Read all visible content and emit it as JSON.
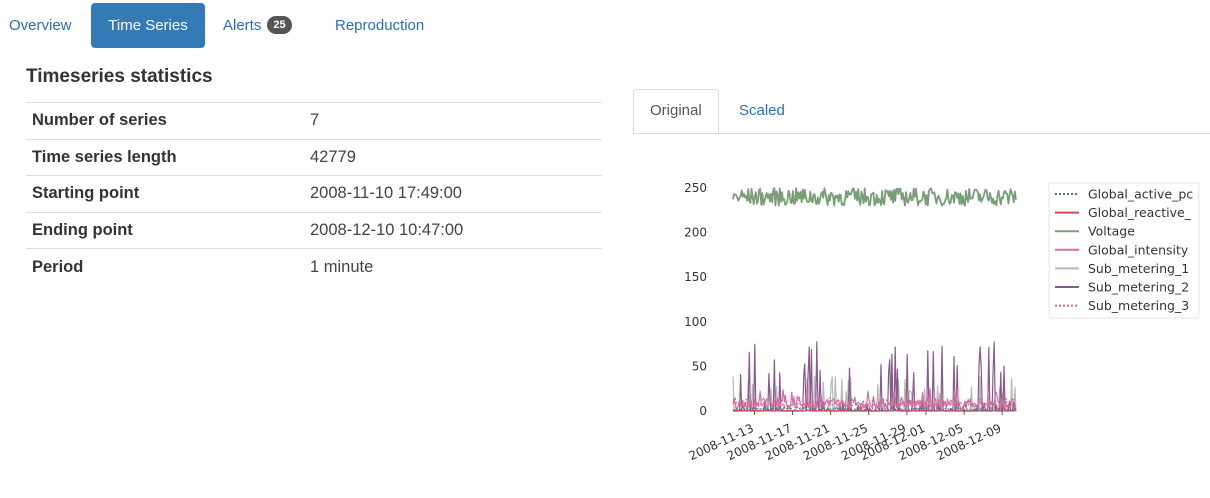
{
  "nav": {
    "items": [
      {
        "label": "Overview",
        "active": false
      },
      {
        "label": "Time Series",
        "active": true
      },
      {
        "label": "Alerts",
        "active": false,
        "badge": "25"
      },
      {
        "label": "Reproduction",
        "active": false
      }
    ]
  },
  "stats": {
    "title": "Timeseries statistics",
    "rows": [
      {
        "label": "Number of series",
        "value": "7"
      },
      {
        "label": "Time series length",
        "value": "42779"
      },
      {
        "label": "Starting point",
        "value": "2008-11-10 17:49:00"
      },
      {
        "label": "Ending point",
        "value": "2008-12-10 10:47:00"
      },
      {
        "label": "Period",
        "value": "1 minute"
      }
    ]
  },
  "chart_tabs": [
    {
      "label": "Original",
      "active": true
    },
    {
      "label": "Scaled",
      "active": false
    }
  ],
  "chart_data": {
    "type": "line",
    "title": "",
    "xlabel": "",
    "ylabel": "",
    "x_range": [
      "2008-11-10 17:49:00",
      "2008-12-10 10:47:00"
    ],
    "xticks": [
      "2008-11-13",
      "2008-11-17",
      "2008-11-21",
      "2008-11-25",
      "2008-11-29",
      "2008-12-01",
      "2008-12-05",
      "2008-12-09"
    ],
    "yticks": [
      0,
      50,
      100,
      150,
      200,
      250
    ],
    "ylim": [
      0,
      255
    ],
    "legend_position": "right",
    "series": [
      {
        "name": "Global_active_pc",
        "color": "#4c72b0",
        "dash": "dotted",
        "approx_level": 1.5,
        "approx_peak": 8
      },
      {
        "name": "Global_reactive_",
        "color": "#c44e52",
        "dash": "solid",
        "approx_level": 0.2,
        "approx_peak": 1
      },
      {
        "name": "Voltage",
        "color": "#7a9e78",
        "dash": "solid",
        "approx_level": 241,
        "approx_range": [
          230,
          250
        ]
      },
      {
        "name": "Global_intensity",
        "color": "#d46ea7",
        "dash": "solid",
        "approx_level": 6,
        "approx_peak": 35
      },
      {
        "name": "Sub_metering_1",
        "color": "#b8b8b8",
        "dash": "solid",
        "approx_level": 0,
        "approx_peak": 40
      },
      {
        "name": "Sub_metering_2",
        "color": "#8a5a8a",
        "dash": "solid",
        "approx_level": 0,
        "approx_peak": 78
      },
      {
        "name": "Sub_metering_3",
        "color": "#d66a86",
        "dash": "dotted",
        "approx_level": 6,
        "approx_peak": 20
      }
    ]
  }
}
